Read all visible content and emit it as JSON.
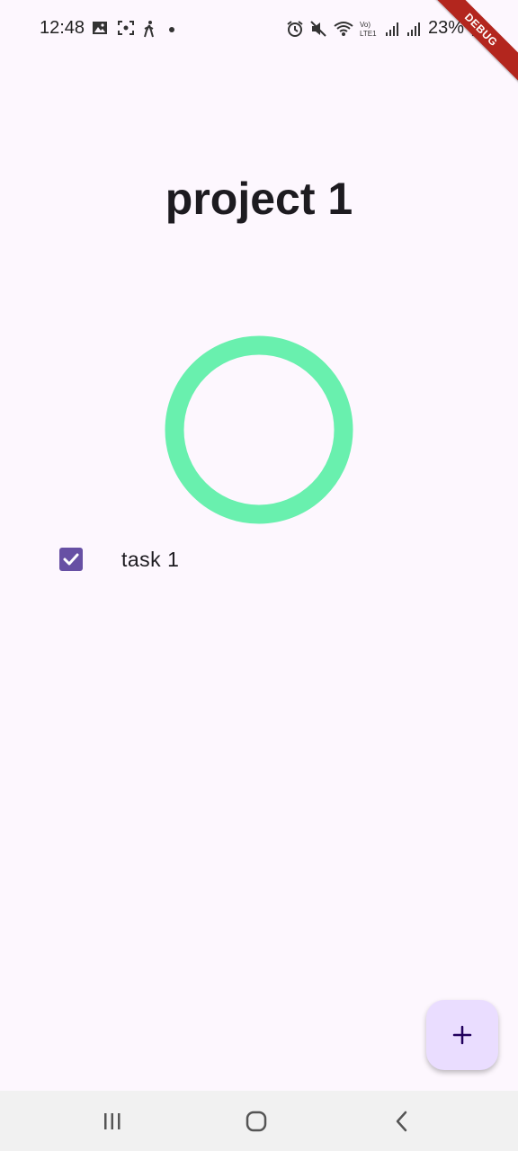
{
  "status_bar": {
    "time": "12:48",
    "battery": "23%",
    "left_icons": [
      "image-icon",
      "screen-capture-icon",
      "walking-icon",
      "dot-icon"
    ],
    "right_icons": [
      "alarm-icon",
      "mute-icon",
      "wifi-icon",
      "volte-icon",
      "signal-icon",
      "signal-icon",
      "battery-icon"
    ]
  },
  "debug_banner": {
    "label": "DEBUG"
  },
  "project": {
    "title": "project 1",
    "progress_color": "#69f0ae"
  },
  "tasks": [
    {
      "label": "task 1",
      "checked": true
    }
  ],
  "fab": {
    "icon": "plus-icon"
  },
  "nav": {
    "buttons": [
      "recents-icon",
      "home-icon",
      "back-icon"
    ]
  },
  "colors": {
    "background": "#fdf7fe",
    "primary": "#6750a4",
    "fab_bg": "#eaddff",
    "debug": "#b3261e"
  }
}
